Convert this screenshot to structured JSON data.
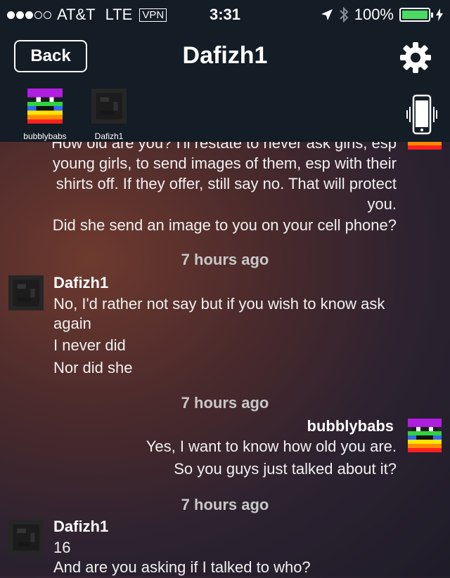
{
  "status_bar": {
    "carrier": "AT&T",
    "network": "LTE",
    "vpn": "VPN",
    "time": "3:31",
    "battery": "100%",
    "signal_bars_filled": 3,
    "signal_bars_total": 5
  },
  "nav": {
    "back_label": "Back",
    "title": "Dafizh1"
  },
  "participants": [
    {
      "name": "bubblybabs"
    },
    {
      "name": "Dafizh1"
    }
  ],
  "messages": {
    "m1_lines": [
      "How old are you?  I'll restate to never ask girls, esp",
      "young girls, to send images of them, esp with their",
      "shirts off.  If they offer, still say no.  That will protect",
      "you.",
      "Did she send an image to you on your cell phone?"
    ],
    "ts1": "7 hours ago",
    "m2_sender": "Dafizh1",
    "m2_lines": [
      "No, I'd rather not say but if you wish to know ask",
      "again",
      "I never did",
      "Nor did she"
    ],
    "ts2": "7 hours ago",
    "m3_sender": "bubblybabs",
    "m3_lines": [
      "Yes, I want to know how old you are.",
      "So you guys just talked about it?"
    ],
    "ts3": "7 hours ago",
    "m4_sender": "Dafizh1",
    "m4_lines": [
      "16",
      "And are you asking if I talked to who?"
    ]
  },
  "colors": {
    "header_bg": "#141c26",
    "battery_green": "#4cd964",
    "timestamp": "#c8c8c8"
  },
  "icons": [
    "settings-gear-icon",
    "phone-vibrate-icon",
    "location-arrow-icon",
    "bluetooth-icon"
  ]
}
